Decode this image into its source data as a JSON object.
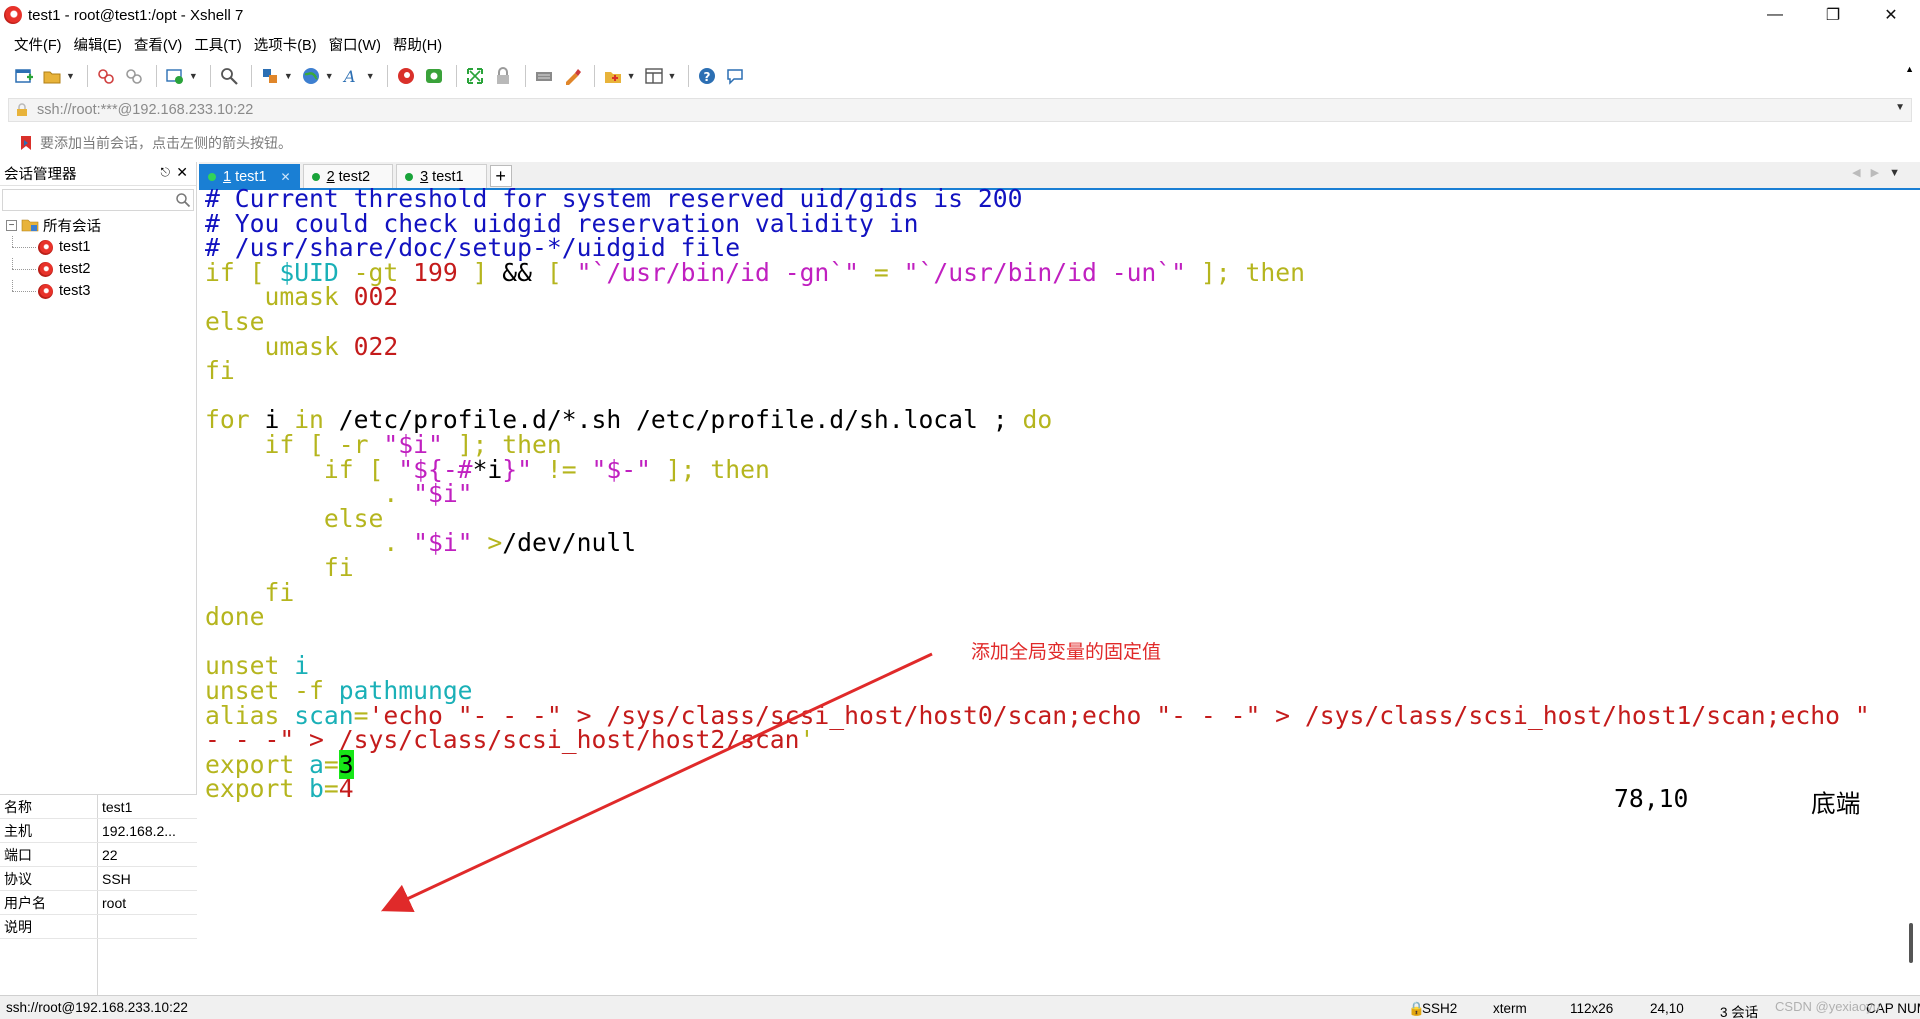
{
  "window": {
    "title": "test1 - root@test1:/opt - Xshell 7",
    "controls": [
      "minimize",
      "restore",
      "close"
    ]
  },
  "menu": [
    "文件(F)",
    "编辑(E)",
    "查看(V)",
    "工具(T)",
    "选项卡(B)",
    "窗口(W)",
    "帮助(H)"
  ],
  "address_bar": {
    "value": "ssh://root:***@192.168.233.10:22"
  },
  "hint_bar": {
    "text": "要添加当前会话，点击左侧的箭头按钮。"
  },
  "session_manager": {
    "title": "会话管理器",
    "search_placeholder": "",
    "root_label": "所有会话",
    "sessions": [
      "test1",
      "test2",
      "test3"
    ]
  },
  "properties": [
    {
      "key": "名称",
      "value": "test1"
    },
    {
      "key": "主机",
      "value": "192.168.2..."
    },
    {
      "key": "端口",
      "value": "22"
    },
    {
      "key": "协议",
      "value": "SSH"
    },
    {
      "key": "用户名",
      "value": "root"
    },
    {
      "key": "说明",
      "value": ""
    }
  ],
  "tabs": [
    {
      "num": "1",
      "label": "test1",
      "active": true
    },
    {
      "num": "2",
      "label": "test2",
      "active": false
    },
    {
      "num": "3",
      "label": "test1",
      "active": false
    }
  ],
  "terminal": {
    "lines": [
      [
        [
          "blue",
          "# Current threshold for system reserved uid/gids is 200"
        ]
      ],
      [
        [
          "blue",
          "# You could check uidgid reservation validity in"
        ]
      ],
      [
        [
          "blue",
          "# /usr/share/doc/setup-*/uidgid file"
        ]
      ],
      [
        [
          "olive",
          "if [ "
        ],
        [
          "teal",
          "$UID"
        ],
        [
          "olive",
          " -gt "
        ],
        [
          "red",
          "199"
        ],
        [
          "olive",
          " ] "
        ],
        [
          "blk",
          "&&"
        ],
        [
          "olive",
          " [ "
        ],
        [
          "mag",
          "\"`/usr/bin/id -gn`\""
        ],
        [
          "olive",
          " = "
        ],
        [
          "mag",
          "\"`/usr/bin/id -un`\""
        ],
        [
          "olive",
          " ]; then"
        ]
      ],
      [
        [
          "olive",
          "    umask "
        ],
        [
          "red",
          "002"
        ]
      ],
      [
        [
          "olive",
          "else"
        ]
      ],
      [
        [
          "olive",
          "    umask "
        ],
        [
          "red",
          "022"
        ]
      ],
      [
        [
          "olive",
          "fi"
        ]
      ],
      [
        [
          "blk",
          ""
        ]
      ],
      [
        [
          "olive",
          "for "
        ],
        [
          "blk",
          "i "
        ],
        [
          "olive",
          "in "
        ],
        [
          "blk",
          "/etc/profile.d/*.sh /etc/profile.d/sh.local ; "
        ],
        [
          "olive",
          "do"
        ]
      ],
      [
        [
          "olive",
          "    if [ -r "
        ],
        [
          "mag",
          "\"$i\""
        ],
        [
          "olive",
          " ]; then"
        ]
      ],
      [
        [
          "olive",
          "        if [ "
        ],
        [
          "mag",
          "\"${-#"
        ],
        [
          "blk",
          "*i"
        ],
        [
          "mag",
          "}\""
        ],
        [
          "olive",
          " != "
        ],
        [
          "mag",
          "\"$-\""
        ],
        [
          "olive",
          " ]; then"
        ]
      ],
      [
        [
          "olive",
          "            . "
        ],
        [
          "mag",
          "\"$i\""
        ]
      ],
      [
        [
          "olive",
          "        else"
        ]
      ],
      [
        [
          "olive",
          "            . "
        ],
        [
          "mag",
          "\"$i\""
        ],
        [
          "blk",
          " "
        ],
        [
          "olive",
          ">"
        ],
        [
          "blk",
          "/dev/null"
        ]
      ],
      [
        [
          "olive",
          "        fi"
        ]
      ],
      [
        [
          "olive",
          "    fi"
        ]
      ],
      [
        [
          "olive",
          "done"
        ]
      ],
      [
        [
          "blk",
          ""
        ]
      ],
      [
        [
          "olive",
          "unset "
        ],
        [
          "teal",
          "i"
        ]
      ],
      [
        [
          "olive",
          "unset -f "
        ],
        [
          "teal",
          "pathmunge"
        ]
      ],
      [
        [
          "olive",
          "alias "
        ],
        [
          "teal",
          "scan"
        ],
        [
          "olive",
          "="
        ],
        [
          "red",
          "'echo \"- - -\" > /sys/class/scsi_host/host0/scan;echo \"- - -\" > /sys/class/scsi_host/host1/scan;echo \""
        ]
      ],
      [
        [
          "red",
          "- - -\" > /sys/class/scsi_host/host2/scan"
        ],
        [
          "olive",
          "'"
        ]
      ],
      [
        [
          "olive",
          "export "
        ],
        [
          "teal",
          "a"
        ],
        [
          "olive",
          "="
        ],
        [
          "cursor",
          "3"
        ]
      ],
      [
        [
          "olive",
          "export "
        ],
        [
          "teal",
          "b"
        ],
        [
          "olive",
          "="
        ],
        [
          "red",
          "4"
        ]
      ]
    ],
    "cursor_position": "78,10",
    "scroll_mode": "底端"
  },
  "annotation": {
    "text": "添加全局变量的固定值",
    "color": "#e02a2a"
  },
  "status_bar": {
    "connection": "ssh://root@192.168.233.10:22",
    "protocol": "SSH2",
    "terminal_type": "xterm",
    "size": "112x26",
    "position": "24,10",
    "sessions": "3 会话",
    "indicators": "CAP NUM",
    "watermark": "CSDN @yexiaoyu"
  }
}
